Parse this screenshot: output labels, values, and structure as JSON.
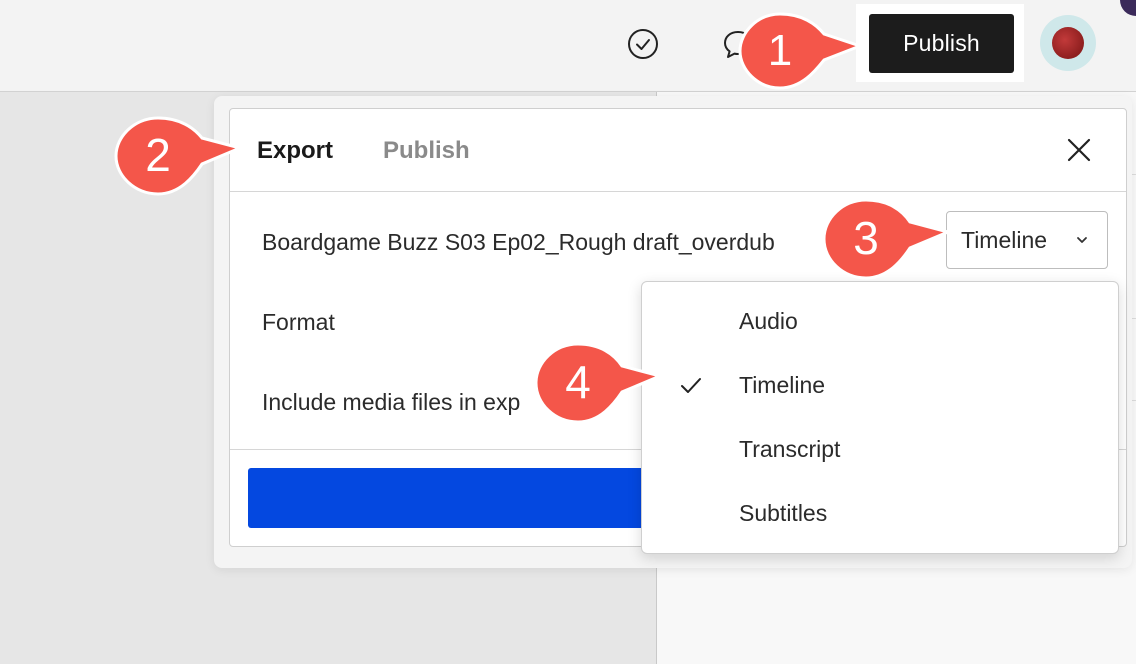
{
  "topbar": {
    "publish_label": "Publish",
    "icons": [
      "check-circle-icon",
      "comment-icon",
      "avatar"
    ]
  },
  "dialog": {
    "tabs": [
      {
        "label": "Export",
        "active": true
      },
      {
        "label": "Publish",
        "active": false
      }
    ],
    "file_name": "Boardgame Buzz S03 Ep02_Rough draft_overdub",
    "format_label": "Format",
    "media_label": "Include media files in exp",
    "selected_value": "Timeline"
  },
  "dropdown": {
    "options": [
      {
        "label": "Audio",
        "checked": false
      },
      {
        "label": "Timeline",
        "checked": true
      },
      {
        "label": "Transcript",
        "checked": false
      },
      {
        "label": "Subtitles",
        "checked": false
      }
    ]
  },
  "callouts": [
    "1",
    "2",
    "3",
    "4"
  ],
  "colors": {
    "callout": "#f4564a",
    "primary": "#0448e0",
    "publish_bg": "#1c1c1c"
  }
}
